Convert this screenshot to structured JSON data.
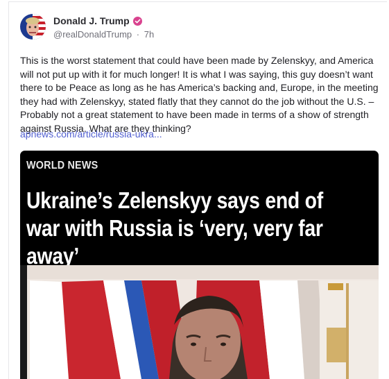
{
  "post": {
    "author_name": "Donald J. Trump",
    "handle": "@realDonaldTrump",
    "separator": "·",
    "time_ago": "7h",
    "body": "This is the worst statement that could have been made by Zelenskyy, and America will not put up with it for much longer! It is what I was saying, this guy doesn’t want there to be Peace as long as he has America’s backing and, Europe, in the meeting they had with Zelenskyy, stated flatly that they cannot do the job without the U.S. – Probably not a great statement to have been made in terms of a show of strength against Russia. What are they thinking?",
    "link_text": "apnews.com/article/russia-ukra..."
  },
  "preview": {
    "section": "WORLD NEWS",
    "headline": "Ukraine’s Zelenskyy says end of war with Russia is ‘very, very far away’"
  },
  "icons": {
    "verified": "verified-badge-icon"
  },
  "colors": {
    "verified_badge": "#d9438f",
    "link": "#5260d0",
    "preview_bg": "#000000"
  }
}
